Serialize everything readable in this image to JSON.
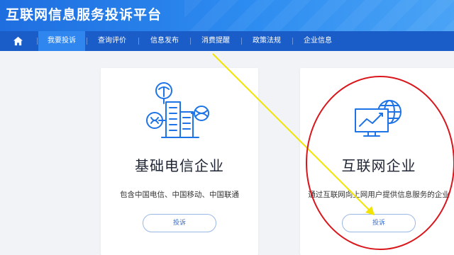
{
  "header": {
    "title": "互联网信息服务投诉平台"
  },
  "nav": {
    "items": [
      {
        "label": "我要投诉",
        "active": true
      },
      {
        "label": "查询评价",
        "active": false
      },
      {
        "label": "信息发布",
        "active": false
      },
      {
        "label": "消费提醒",
        "active": false
      },
      {
        "label": "政策法规",
        "active": false
      },
      {
        "label": "企业信息",
        "active": false
      }
    ]
  },
  "cards": {
    "telecom": {
      "title": "基础电信企业",
      "description": "包含中国电信、中国移动、中国联通",
      "button": "投诉",
      "icon": "telecom-buildings-icon"
    },
    "internet": {
      "title": "互联网企业",
      "description": "通过互联网向上网用户提供信息服务的企业",
      "button": "投诉",
      "icon": "monitor-globe-icon"
    }
  },
  "annotations": {
    "arrow_color": "#f2e400",
    "circle_color": "#d9161c"
  },
  "colors": {
    "header": "#1f6ee0",
    "nav": "#1a5dc9",
    "nav_active": "#2f86ee",
    "icon_blue": "#1e74e6"
  }
}
